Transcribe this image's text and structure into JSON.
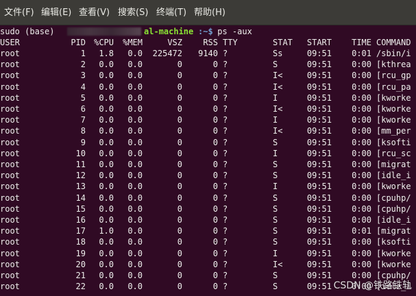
{
  "menu": [
    "文件(F)",
    "编辑(E)",
    "查看(V)",
    "搜索(S)",
    "终端(T)",
    "帮助(H)"
  ],
  "prompt": {
    "user": "sudo (base) ",
    "host_tail": "al-machine",
    "path": ":~$",
    "command": " ps -aux"
  },
  "headers": [
    "USER",
    "PID",
    "%CPU",
    "%MEM",
    "VSZ",
    "RSS",
    "TTY",
    "STAT",
    "START",
    "TIME",
    "COMMAND"
  ],
  "rows": [
    [
      "root",
      "1",
      "1.8",
      "0.0",
      "225472",
      "9140",
      "?",
      "Ss",
      "09:51",
      "0:01",
      "/sbin/i"
    ],
    [
      "root",
      "2",
      "0.0",
      "0.0",
      "0",
      "0",
      "?",
      "S",
      "09:51",
      "0:00",
      "[kthrea"
    ],
    [
      "root",
      "3",
      "0.0",
      "0.0",
      "0",
      "0",
      "?",
      "I<",
      "09:51",
      "0:00",
      "[rcu_gp"
    ],
    [
      "root",
      "4",
      "0.0",
      "0.0",
      "0",
      "0",
      "?",
      "I<",
      "09:51",
      "0:00",
      "[rcu_pa"
    ],
    [
      "root",
      "5",
      "0.0",
      "0.0",
      "0",
      "0",
      "?",
      "I",
      "09:51",
      "0:00",
      "[kworke"
    ],
    [
      "root",
      "6",
      "0.0",
      "0.0",
      "0",
      "0",
      "?",
      "I<",
      "09:51",
      "0:00",
      "[kworke"
    ],
    [
      "root",
      "7",
      "0.0",
      "0.0",
      "0",
      "0",
      "?",
      "I",
      "09:51",
      "0:00",
      "[kworke"
    ],
    [
      "root",
      "8",
      "0.0",
      "0.0",
      "0",
      "0",
      "?",
      "I<",
      "09:51",
      "0:00",
      "[mm_per"
    ],
    [
      "root",
      "9",
      "0.0",
      "0.0",
      "0",
      "0",
      "?",
      "S",
      "09:51",
      "0:00",
      "[ksofti"
    ],
    [
      "root",
      "10",
      "0.0",
      "0.0",
      "0",
      "0",
      "?",
      "I",
      "09:51",
      "0:00",
      "[rcu_sc"
    ],
    [
      "root",
      "11",
      "0.0",
      "0.0",
      "0",
      "0",
      "?",
      "S",
      "09:51",
      "0:00",
      "[migrat"
    ],
    [
      "root",
      "12",
      "0.0",
      "0.0",
      "0",
      "0",
      "?",
      "S",
      "09:51",
      "0:00",
      "[idle_i"
    ],
    [
      "root",
      "13",
      "0.0",
      "0.0",
      "0",
      "0",
      "?",
      "I",
      "09:51",
      "0:00",
      "[kworke"
    ],
    [
      "root",
      "14",
      "0.0",
      "0.0",
      "0",
      "0",
      "?",
      "S",
      "09:51",
      "0:00",
      "[cpuhp/"
    ],
    [
      "root",
      "15",
      "0.0",
      "0.0",
      "0",
      "0",
      "?",
      "S",
      "09:51",
      "0:00",
      "[cpuhp/"
    ],
    [
      "root",
      "16",
      "0.0",
      "0.0",
      "0",
      "0",
      "?",
      "S",
      "09:51",
      "0:00",
      "[idle_i"
    ],
    [
      "root",
      "17",
      "1.0",
      "0.0",
      "0",
      "0",
      "?",
      "S",
      "09:51",
      "0:01",
      "[migrat"
    ],
    [
      "root",
      "18",
      "0.0",
      "0.0",
      "0",
      "0",
      "?",
      "S",
      "09:51",
      "0:00",
      "[ksofti"
    ],
    [
      "root",
      "19",
      "0.0",
      "0.0",
      "0",
      "0",
      "?",
      "I",
      "09:51",
      "0:00",
      "[kworke"
    ],
    [
      "root",
      "20",
      "0.0",
      "0.0",
      "0",
      "0",
      "?",
      "I<",
      "09:51",
      "0:00",
      "[kworke"
    ],
    [
      "root",
      "21",
      "0.0",
      "0.0",
      "0",
      "0",
      "?",
      "S",
      "09:51",
      "0:00",
      "[cpuhp/"
    ],
    [
      "root",
      "22",
      "0.0",
      "0.0",
      "0",
      "0",
      "?",
      "S",
      "09:51",
      "0:00",
      "[idle_i"
    ]
  ],
  "watermark": "CSDN @铁路铁轨"
}
